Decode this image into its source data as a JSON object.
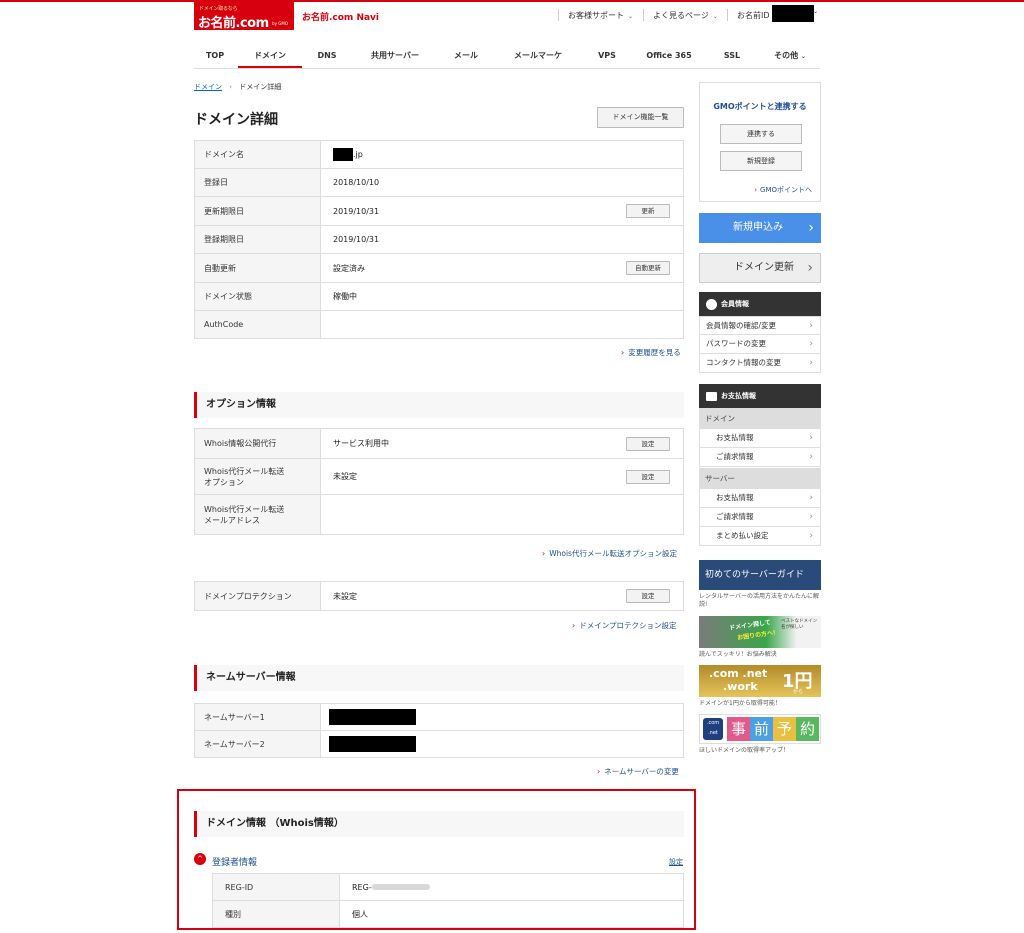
{
  "header": {
    "logo": {
      "tagline": "ドメイン取るなら",
      "name": "お名前.com",
      "sub": "by GMO"
    },
    "navi_title": "お名前.com Navi",
    "support": "お客様サポート",
    "faq": "よく見るページ",
    "id_label": "お名前ID"
  },
  "nav": [
    "TOP",
    "ドメイン",
    "DNS",
    "共用サーバー",
    "メール",
    "メールマーケ",
    "VPS",
    "Office 365",
    "SSL",
    "その他"
  ],
  "breadcrumb": {
    "root": "ドメイン",
    "current": "ドメイン詳細"
  },
  "page_title": "ドメイン詳細",
  "domain_list_btn": "ドメイン機能一覧",
  "detail": {
    "domain_name_label": "ドメイン名",
    "domain_suffix": ".jp",
    "reg_date_label": "登録日",
    "reg_date": "2018/10/10",
    "renew_label": "更新期限日",
    "renew": "2019/10/31",
    "renew_btn": "更新",
    "expire_label": "登録期限日",
    "expire": "2019/10/31",
    "auto_label": "自動更新",
    "auto": "設定済み",
    "auto_btn": "自動更新",
    "status_label": "ドメイン状態",
    "status": "稼働中",
    "auth_label": "AuthCode"
  },
  "history_link": "変更履歴を見る",
  "option": {
    "title": "オプション情報",
    "whois_label": "Whois情報公開代行",
    "whois": "サービス利用中",
    "whois_btn": "設定",
    "mail_label_1": "Whois代行メール転送",
    "mail_label_2": "オプション",
    "mail": "未設定",
    "mail_btn": "設定",
    "addr_label_1": "Whois代行メール転送",
    "addr_label_2": "メールアドレス",
    "link": "Whois代行メール転送オプション設定"
  },
  "protection": {
    "label": "ドメインプロテクション",
    "value": "未設定",
    "btn": "設定",
    "link": "ドメインプロテクション設定"
  },
  "ns": {
    "title": "ネームサーバー情報",
    "ns1_label": "ネームサーバー1",
    "ns2_label": "ネームサーバー2",
    "link": "ネームサーバーの変更"
  },
  "whois": {
    "title": "ドメイン情報 （Whois情報）",
    "acc_label": "登録者情報",
    "acc_set": "設定",
    "regid_label": "REG-ID",
    "regid_prefix": "REG-",
    "type_label": "種別",
    "type": "個人"
  },
  "sidebar": {
    "gmo_title": "GMOポイントと連携する",
    "gmo_link_btn": "連携する",
    "gmo_new_btn": "新規登録",
    "gmo_link": "GMOポイントへ",
    "apply": "新規申込み",
    "renew": "ドメイン更新",
    "member_title": "会員情報",
    "member_items": [
      "会員情報の確認/変更",
      "パスワードの変更",
      "コンタクト情報の変更"
    ],
    "pay_title": "お支払情報",
    "domain_group": "ドメイン",
    "domain_items": [
      "お支払情報",
      "ご請求情報"
    ],
    "server_group": "サーバー",
    "server_items": [
      "お支払情報",
      "ご請求情報",
      "まとめ払い設定"
    ],
    "guide_banner": "初めてのサーバーガイド",
    "guide_cap": "レンタルサーバーの活用方法をかんたんに解説!",
    "manga_text1": "ドメイン探して",
    "manga_text2": "お困りの方へ!",
    "manga_text3": "ベストなドメイン名が探しい",
    "manga_cap": "読んでスッキリ！お悩み解決",
    "yen_text1": ".com",
    ".net": "",
    "yen_a": ".com",
    ".yen_b": "",
    "yen_line1": ".com .net",
    "yen_line2": ".work",
    "yen_price": "1円",
    "yen_kara": "から",
    "yen_cap": "ドメインが1円から取得可能！",
    "pre_badge_1": ".com",
    "pre_badge_2": ".net",
    "pre_chars": [
      "事",
      "前",
      "予",
      "約"
    ],
    "pre_cap": "ほしいドメインの取得率アップ！"
  },
  "colors": {
    "brand_red": "#d7000f",
    "link_blue": "#1f4f8f",
    "apply_blue": "#4a90e8",
    "dark": "#333333"
  }
}
